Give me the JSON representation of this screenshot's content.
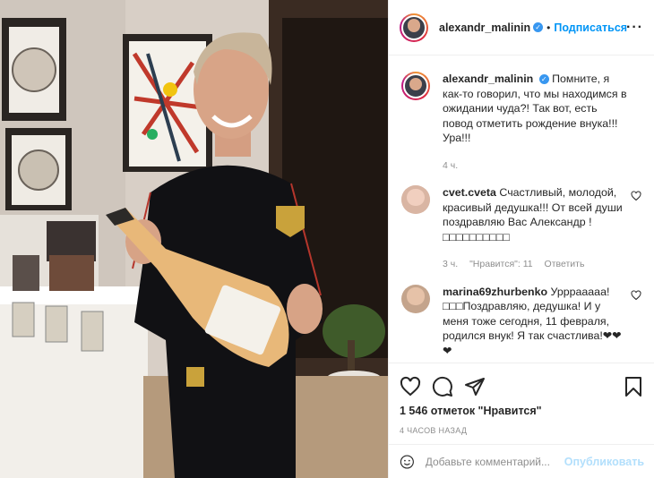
{
  "post": {
    "username": "alexandr_malinin",
    "follow_label": "Подписаться",
    "dot": "•",
    "more_label": "···"
  },
  "caption": {
    "username": "alexandr_malinin",
    "text": "Помните, я как-то говорил, что мы находимся в ожидании чуда?! Так вот, есть повод отметить рождение внука!!! Ура!!!",
    "time": "4 ч."
  },
  "comments": [
    {
      "username": "cvet.cveta",
      "text": "Счастливый, молодой, красивый дедушка!!! От всей души поздравляю Вас Александр !□□□□□□□□□□",
      "time": "3 ч.",
      "likes": "\"Нравится\": 11",
      "reply_label": "Ответить"
    },
    {
      "username": "marina69zhurbenko",
      "text": "Урррааааа! □□□Поздравляю, дедушка! И у меня тоже сегодня, 11 февраля, родился внук! Я так счастлива!❤❤❤"
    }
  ],
  "actions": {
    "likes_text": "1 546 отметок \"Нравится\"",
    "timestamp": "4 часов назад"
  },
  "add_comment": {
    "placeholder": "Добавьте комментарий...",
    "publish_label": "Опубликовать"
  },
  "colors": {
    "accent": "#0095f6",
    "publish_disabled": "#b2dffc",
    "muted": "#8e8e8e"
  }
}
